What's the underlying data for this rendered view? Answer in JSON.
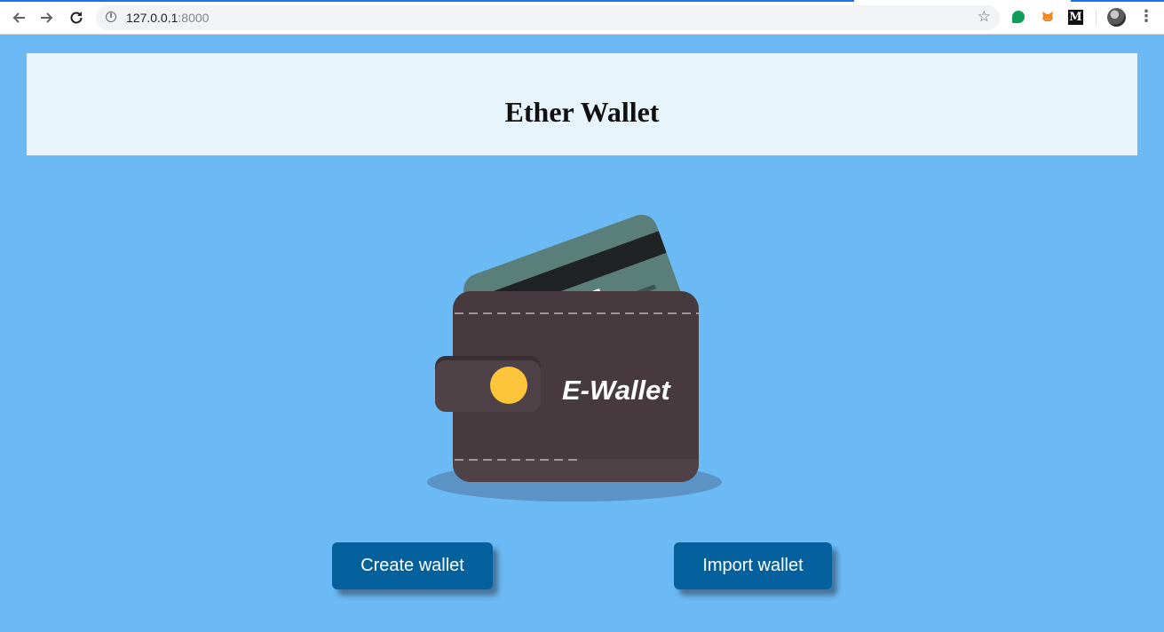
{
  "browser": {
    "url_host": "127.0.0.1",
    "url_port": ":8000",
    "icons": [
      "back-icon",
      "forward-icon",
      "reload-icon",
      "info-icon",
      "star-icon",
      "extension-green-icon",
      "metamask-fox-icon",
      "medium-icon",
      "profile-avatar",
      "menu-kebab-icon"
    ],
    "medium_glyph": "M"
  },
  "header": {
    "title": "Ether Wallet"
  },
  "wallet": {
    "label": "E-Wallet",
    "colors": {
      "body": "#463a3e",
      "body_bottom": "#4f4246",
      "card": "#5a7f7b",
      "stripe": "#1f2323",
      "coin": "#ffc53a",
      "shadow": "#5a93c4"
    }
  },
  "actions": {
    "create_label": "Create wallet",
    "import_label": "Import wallet"
  },
  "colors": {
    "page_bg": "#6bbaf5",
    "header_bg": "#e8f4fb",
    "button_bg": "#04619e"
  }
}
